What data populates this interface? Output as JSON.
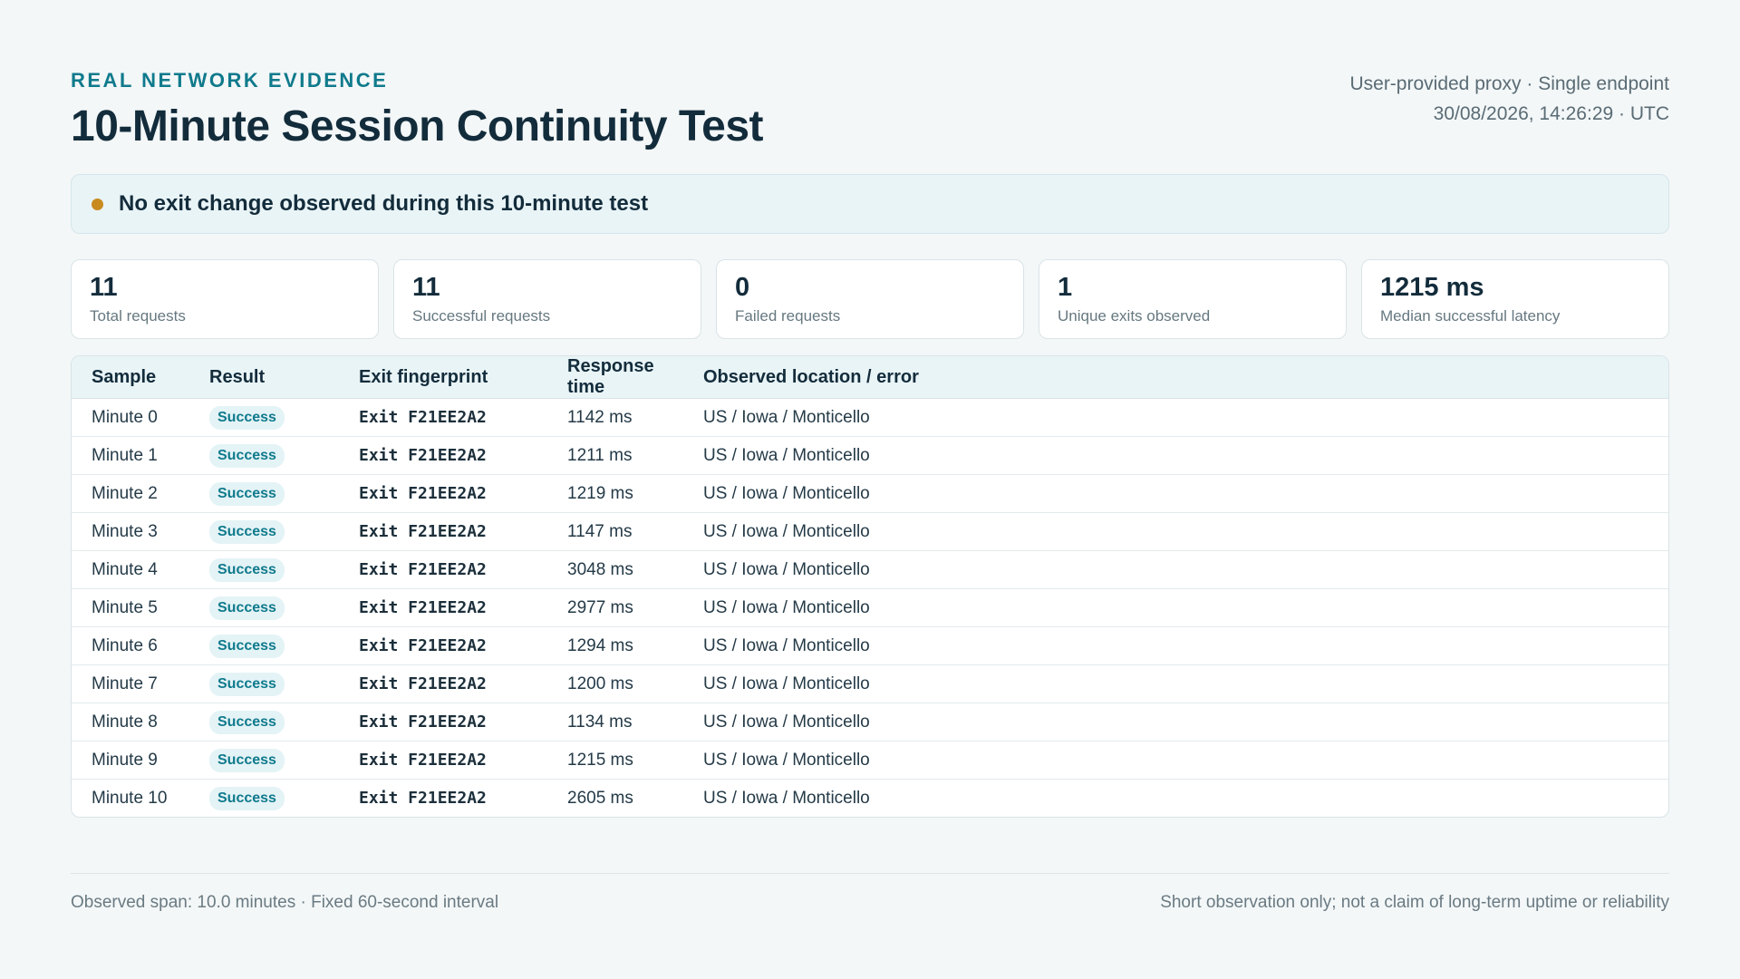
{
  "header": {
    "eyebrow": "REAL NETWORK EVIDENCE",
    "title": "10-Minute Session Continuity Test",
    "meta_line1": "User-provided proxy · Single endpoint",
    "meta_line2": "30/08/2026, 14:26:29 · UTC"
  },
  "banner": {
    "text": "No exit change observed during this 10-minute test",
    "dot_color": "#c98a1e"
  },
  "stats": [
    {
      "value": "11",
      "label": "Total requests"
    },
    {
      "value": "11",
      "label": "Successful requests"
    },
    {
      "value": "0",
      "label": "Failed requests"
    },
    {
      "value": "1",
      "label": "Unique exits observed"
    },
    {
      "value": "1215 ms",
      "label": "Median successful latency"
    }
  ],
  "table": {
    "headers": [
      "Sample",
      "Result",
      "Exit fingerprint",
      "Response time",
      "Observed location / error"
    ],
    "rows": [
      {
        "sample": "Minute 0",
        "result": "Success",
        "exit": "Exit F21EE2A2",
        "response": "1142 ms",
        "location": "US / Iowa / Monticello"
      },
      {
        "sample": "Minute 1",
        "result": "Success",
        "exit": "Exit F21EE2A2",
        "response": "1211 ms",
        "location": "US / Iowa / Monticello"
      },
      {
        "sample": "Minute 2",
        "result": "Success",
        "exit": "Exit F21EE2A2",
        "response": "1219 ms",
        "location": "US / Iowa / Monticello"
      },
      {
        "sample": "Minute 3",
        "result": "Success",
        "exit": "Exit F21EE2A2",
        "response": "1147 ms",
        "location": "US / Iowa / Monticello"
      },
      {
        "sample": "Minute 4",
        "result": "Success",
        "exit": "Exit F21EE2A2",
        "response": "3048 ms",
        "location": "US / Iowa / Monticello"
      },
      {
        "sample": "Minute 5",
        "result": "Success",
        "exit": "Exit F21EE2A2",
        "response": "2977 ms",
        "location": "US / Iowa / Monticello"
      },
      {
        "sample": "Minute 6",
        "result": "Success",
        "exit": "Exit F21EE2A2",
        "response": "1294 ms",
        "location": "US / Iowa / Monticello"
      },
      {
        "sample": "Minute 7",
        "result": "Success",
        "exit": "Exit F21EE2A2",
        "response": "1200 ms",
        "location": "US / Iowa / Monticello"
      },
      {
        "sample": "Minute 8",
        "result": "Success",
        "exit": "Exit F21EE2A2",
        "response": "1134 ms",
        "location": "US / Iowa / Monticello"
      },
      {
        "sample": "Minute 9",
        "result": "Success",
        "exit": "Exit F21EE2A2",
        "response": "1215 ms",
        "location": "US / Iowa / Monticello"
      },
      {
        "sample": "Minute 10",
        "result": "Success",
        "exit": "Exit F21EE2A2",
        "response": "2605 ms",
        "location": "US / Iowa / Monticello"
      }
    ]
  },
  "footer": {
    "left": "Observed span: 10.0 minutes · Fixed 60-second interval",
    "right": "Short observation only; not a claim of long-term uptime or reliability"
  },
  "colors": {
    "accent": "#0f7a8c",
    "background": "#f3f7f8",
    "success_badge_bg": "#e4f3f6"
  }
}
